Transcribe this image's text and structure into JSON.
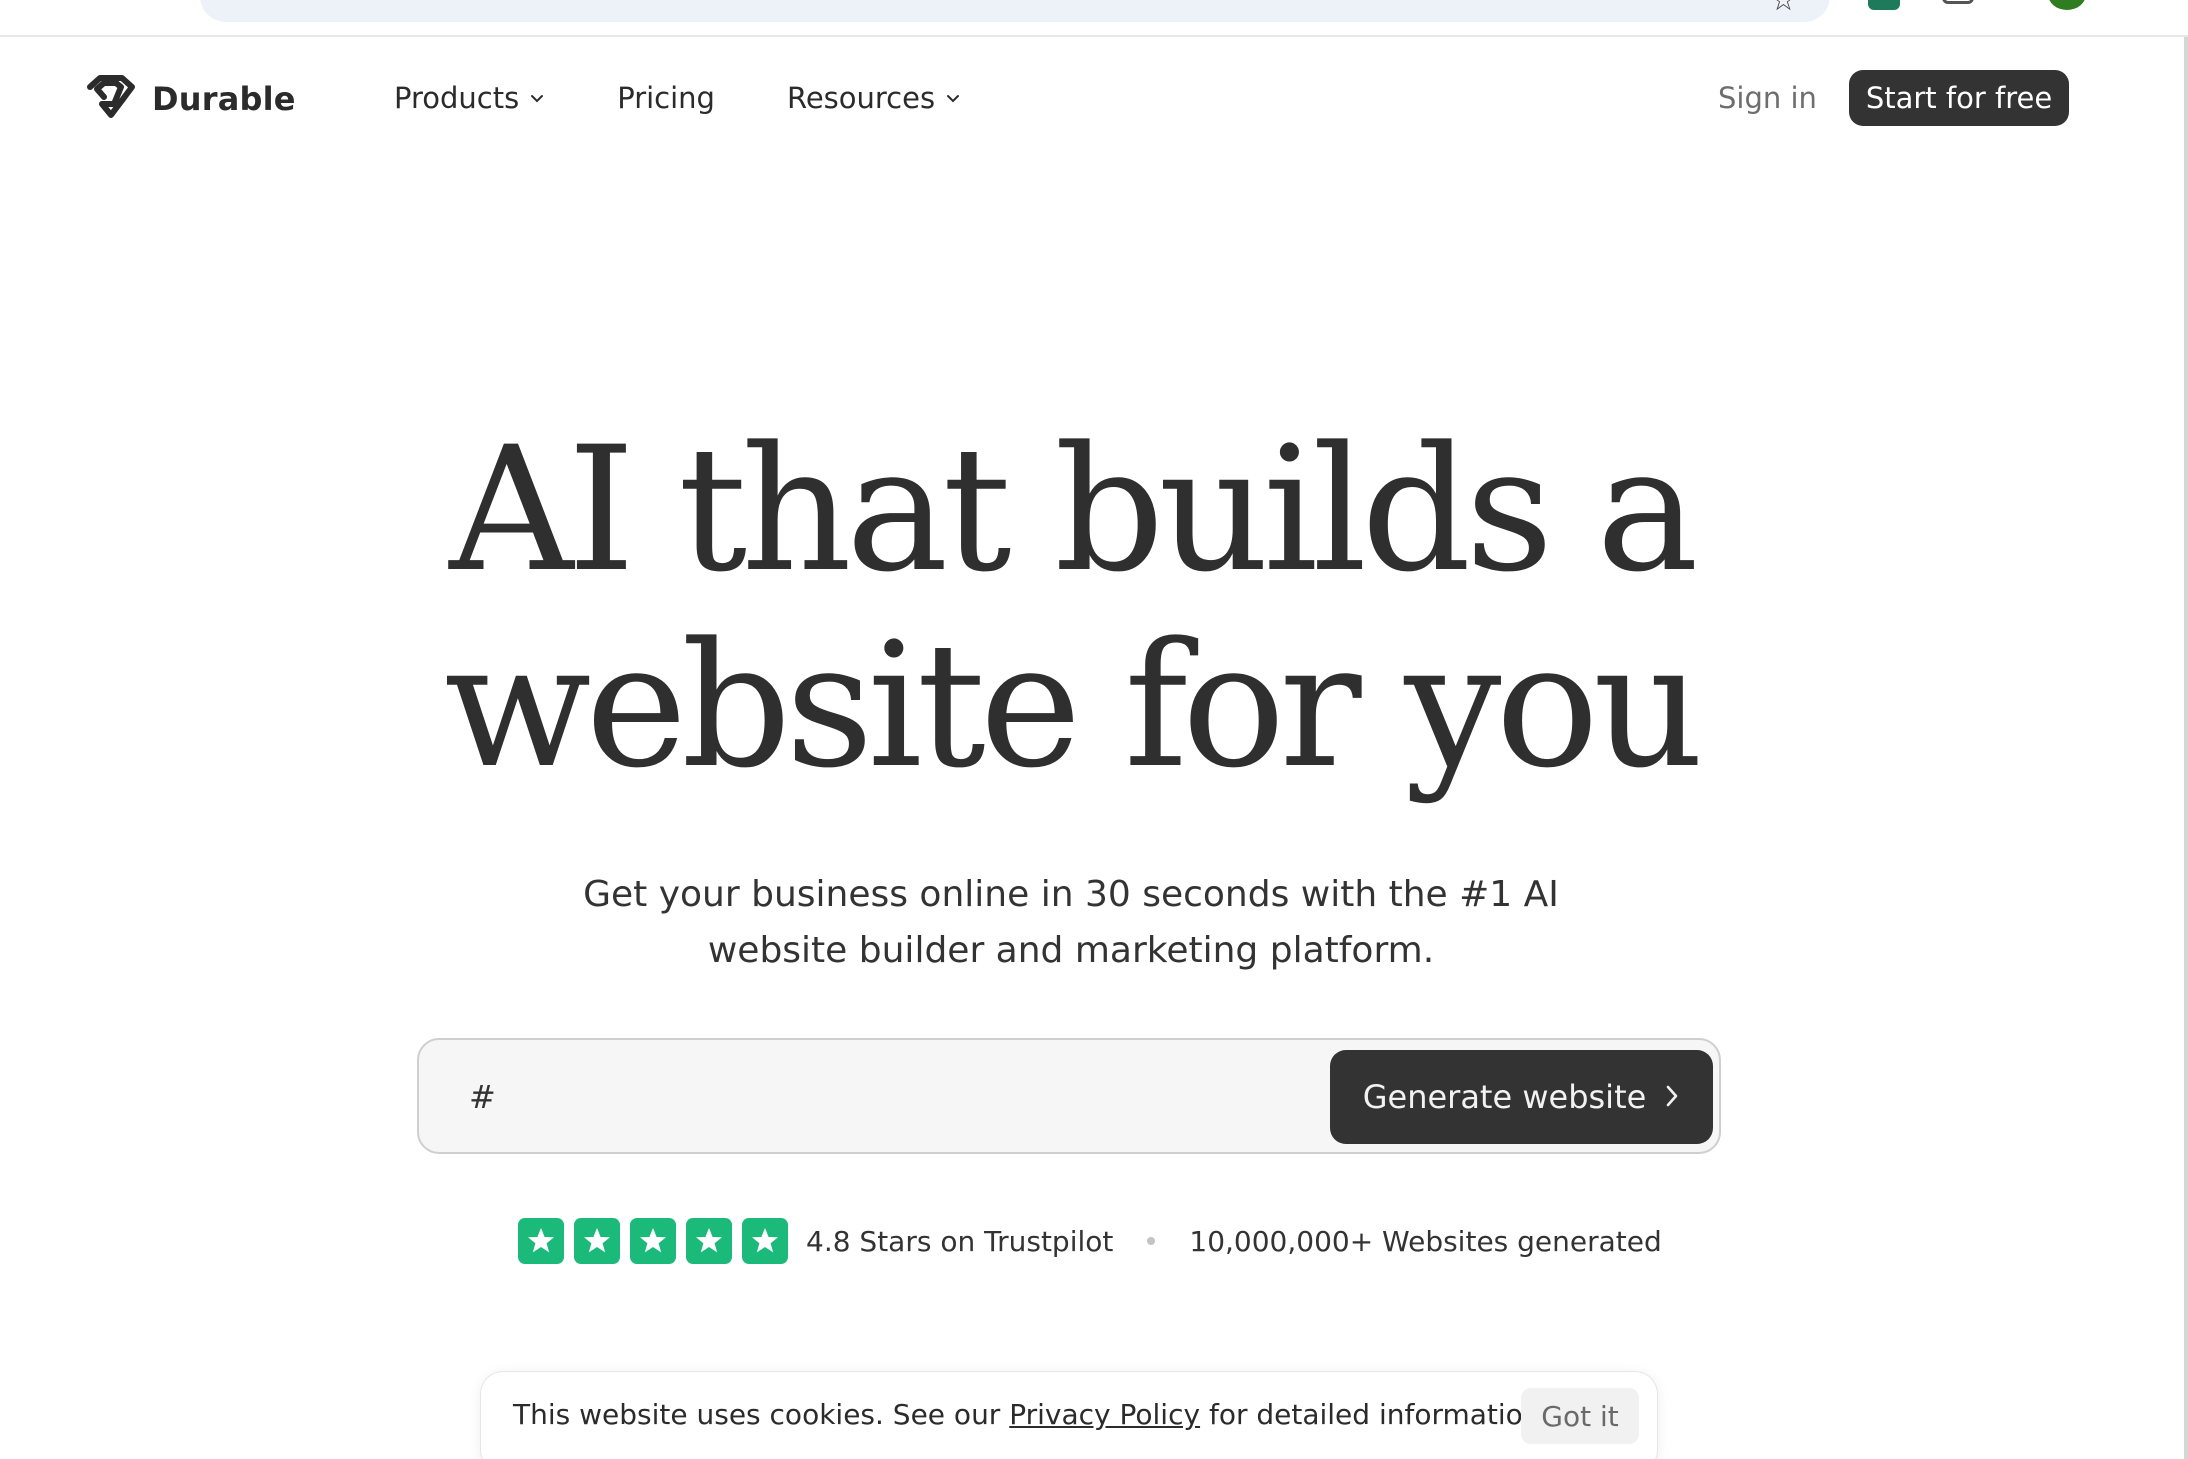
{
  "brand": {
    "name": "Durable",
    "logo_icon": "diamond-logo-icon"
  },
  "nav": {
    "items": [
      {
        "label": "Products",
        "has_dropdown": true
      },
      {
        "label": "Pricing",
        "has_dropdown": false
      },
      {
        "label": "Resources",
        "has_dropdown": true
      }
    ],
    "sign_in": "Sign in",
    "cta": "Start for free"
  },
  "hero": {
    "title_line1": "AI that builds a",
    "title_line2": "website for you",
    "subtitle_line1": "Get your business online in 30 seconds with the #1 AI",
    "subtitle_line2": "website builder and marketing platform."
  },
  "generator": {
    "input_value": "#",
    "button_label": "Generate website"
  },
  "trust": {
    "rating_value": 4.8,
    "rating_max": 5,
    "rating_text": "4.8 Stars on Trustpilot",
    "websites_text": "10,000,000+ Websites generated"
  },
  "cookie": {
    "text_before": "This website uses cookies. See our ",
    "link_text": "Privacy Policy",
    "text_after": " for detailed information.",
    "button_label": "Got it"
  },
  "colors": {
    "primary_dark": "#333333",
    "trustpilot_green": "#1cba7a",
    "text": "#2b2b2b",
    "muted": "#6e6e6e"
  }
}
